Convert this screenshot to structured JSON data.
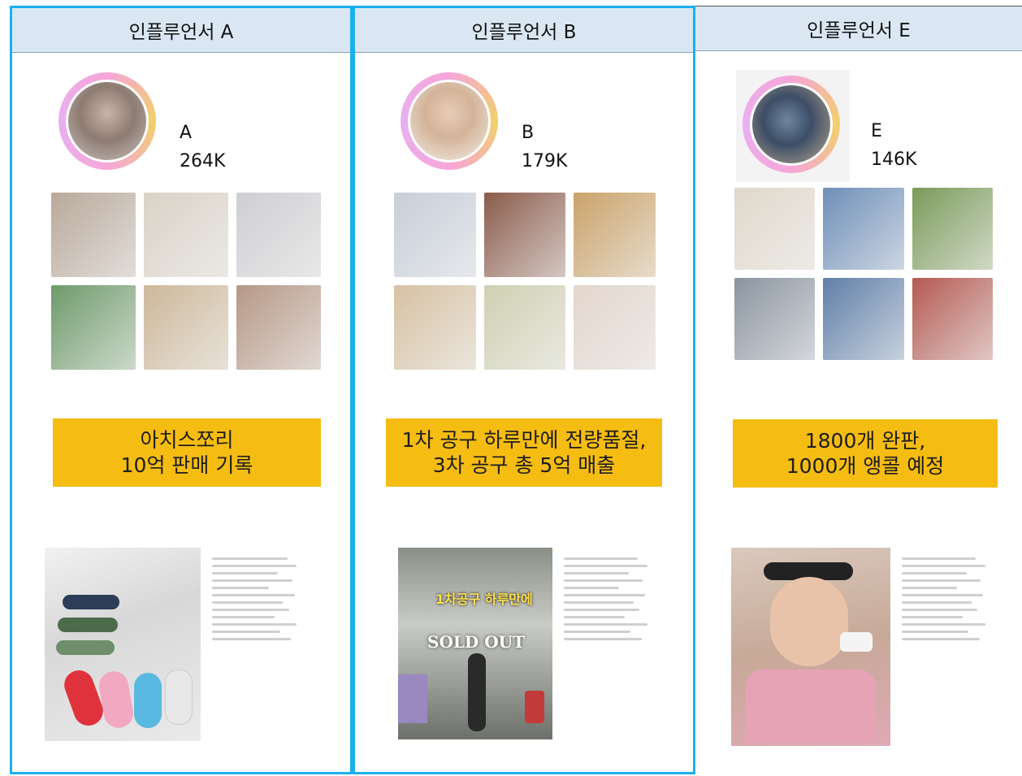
{
  "columns": [
    {
      "header": "인플루언서 A",
      "handle": "A",
      "followers": "264K",
      "banner_line1": "아치스쪼리",
      "banner_line2": "10억 판매 기록",
      "tiles": [
        "#b9a99b",
        "#d9d2c6",
        "#cfcfd2",
        "#6e9a6a",
        "#cdb89a",
        "#b69886"
      ]
    },
    {
      "header": "인플루언서 B",
      "handle": "B",
      "followers": "179K",
      "banner_line1": "1차 공구 하루만에 전량품절,",
      "banner_line2": "3차 공구 총 5억 매출",
      "tiles": [
        "#c7cfda",
        "#8a5c4c",
        "#caa36a",
        "#d7c2a4",
        "#cfd0b2",
        "#e3d6cc"
      ],
      "overlay_tag": "1차공구 하루만에",
      "overlay_big": "SOLD OUT"
    },
    {
      "header": "인플루언서 E",
      "handle": "E",
      "followers": "146K",
      "banner_line1": "1800개 완판,",
      "banner_line2": "1000개 앵콜 예정",
      "tiles": [
        "#e0d8cb",
        "#6e8fb8",
        "#7b9a5a",
        "#8a94a0",
        "#5f7fa8",
        "#b35a52"
      ]
    }
  ],
  "colors": {
    "accent_border": "#1ab0ec",
    "header_bg": "#dae7f3",
    "banner_bg": "#f5bc12"
  }
}
